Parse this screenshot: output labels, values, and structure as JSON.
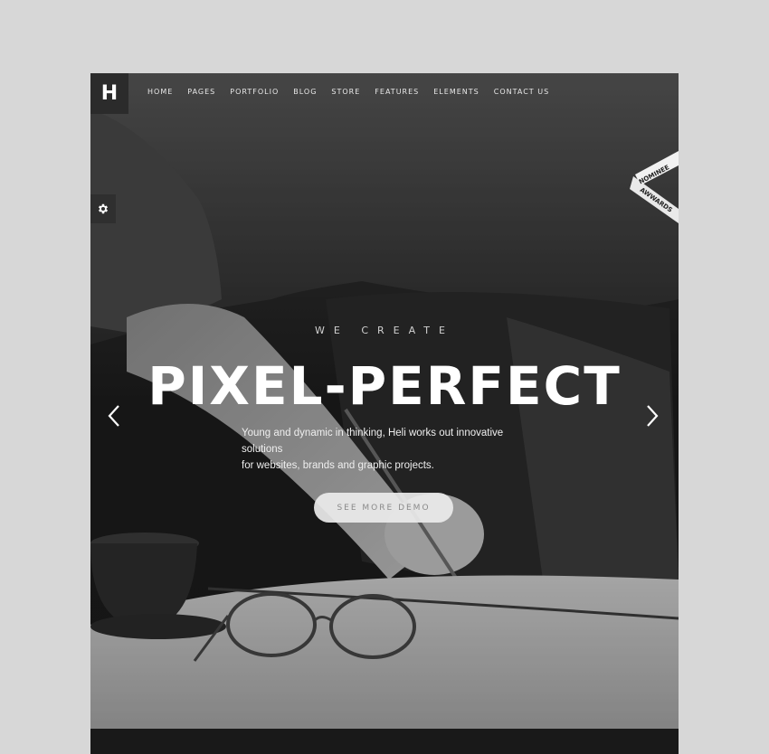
{
  "header": {
    "logo_letter": "H",
    "nav": [
      "HOME",
      "PAGES",
      "PORTFOLIO",
      "BLOG",
      "STORE",
      "FEATURES",
      "ELEMENTS",
      "CONTACT US"
    ]
  },
  "badge": {
    "top": "NOMINEE",
    "bottom": "AWWARDS"
  },
  "hero": {
    "pre_title": "WE CREATE",
    "title": "PIXEL-PERFECT",
    "description_line1": "Young and dynamic in thinking, Heli works out innovative solutions",
    "description_line2": "for websites, brands and graphic projects.",
    "cta_label": "SEE MORE DEMO"
  },
  "icons": {
    "settings": "gear-icon",
    "prev": "chevron-left-icon",
    "next": "chevron-right-icon"
  },
  "colors": {
    "page_bg": "#d7d7d7",
    "hero_text": "#ffffff",
    "cta_bg": "#ebebeb",
    "logo_bg": "#2b2b2b"
  }
}
